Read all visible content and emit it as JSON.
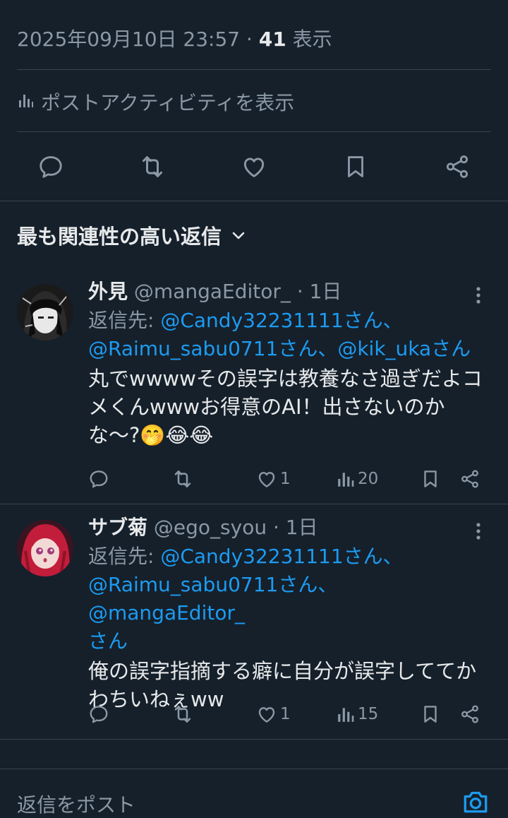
{
  "post_meta": {
    "datetime": "2025年09月10日 23:57 · ",
    "views": "41",
    "views_label": " 表示"
  },
  "activity_label": "ポストアクティビティを表示",
  "sort_label": "最も関連性の高い返信",
  "replies": [
    {
      "name": "外見",
      "handle": "@mangaEditor_",
      "time": "· 1日",
      "reply_to_label": "返信先: ",
      "mentions_line1": "@Candy32231111さん、",
      "mentions_line2a": "@Raimu_sabu0711さん、",
      "mentions_line2b": "@kik_ukaさん",
      "text": "丸でwwwwその誤字は教養なさ過ぎだよコメくんwwwお得意のAI！出さないのかな〜?🤭😂😂",
      "likes": "1",
      "views": "20"
    },
    {
      "name": "サブ菊",
      "handle": "@ego_syou",
      "time": "· 1日",
      "reply_to_label": "返信先: ",
      "mentions_line1": "@Candy32231111さん、",
      "mentions_line2a": "@Raimu_sabu0711さん、",
      "mentions_line2b": "@mangaEditor_",
      "mentions_line3": "さん",
      "text": "俺の誤字指摘する癖に自分が誤字しててかわちいねぇww",
      "likes": "1",
      "views": "15"
    }
  ],
  "composer_placeholder": "返信をポスト",
  "colors": {
    "background": "#15202b",
    "accent": "#1d9bf0",
    "muted": "#8b98a5",
    "divider": "#38444d"
  },
  "icons": [
    "reply-icon",
    "retweet-icon",
    "like-icon",
    "bookmark-icon",
    "share-icon",
    "views-icon",
    "more-icon",
    "chevron-down-icon",
    "camera-icon"
  ]
}
